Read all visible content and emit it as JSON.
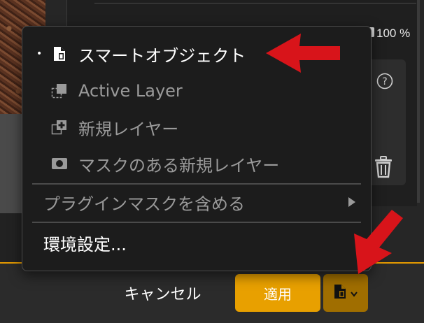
{
  "background": {
    "zoom": "100 %"
  },
  "menu": {
    "items": [
      {
        "label": "スマートオブジェクト",
        "icon": "smart-object-icon",
        "selected": true,
        "enabled": true
      },
      {
        "label": "Active Layer",
        "icon": "active-layer-icon",
        "selected": false,
        "enabled": false
      },
      {
        "label": "新規レイヤー",
        "icon": "new-layer-icon",
        "selected": false,
        "enabled": false
      },
      {
        "label": "マスクのある新規レイヤー",
        "icon": "layer-mask-icon",
        "selected": false,
        "enabled": false
      }
    ],
    "plugin_mask": {
      "label": "プラグインマスクを含める",
      "enabled": false
    },
    "preferences": {
      "label": "環境設定..."
    },
    "bullet": "•"
  },
  "footer": {
    "cancel_label": "キャンセル",
    "apply_label": "適用",
    "output_icon": "smart-object-icon"
  },
  "colors": {
    "accent": "#e8a000",
    "annotation_arrow": "#d8141a"
  }
}
